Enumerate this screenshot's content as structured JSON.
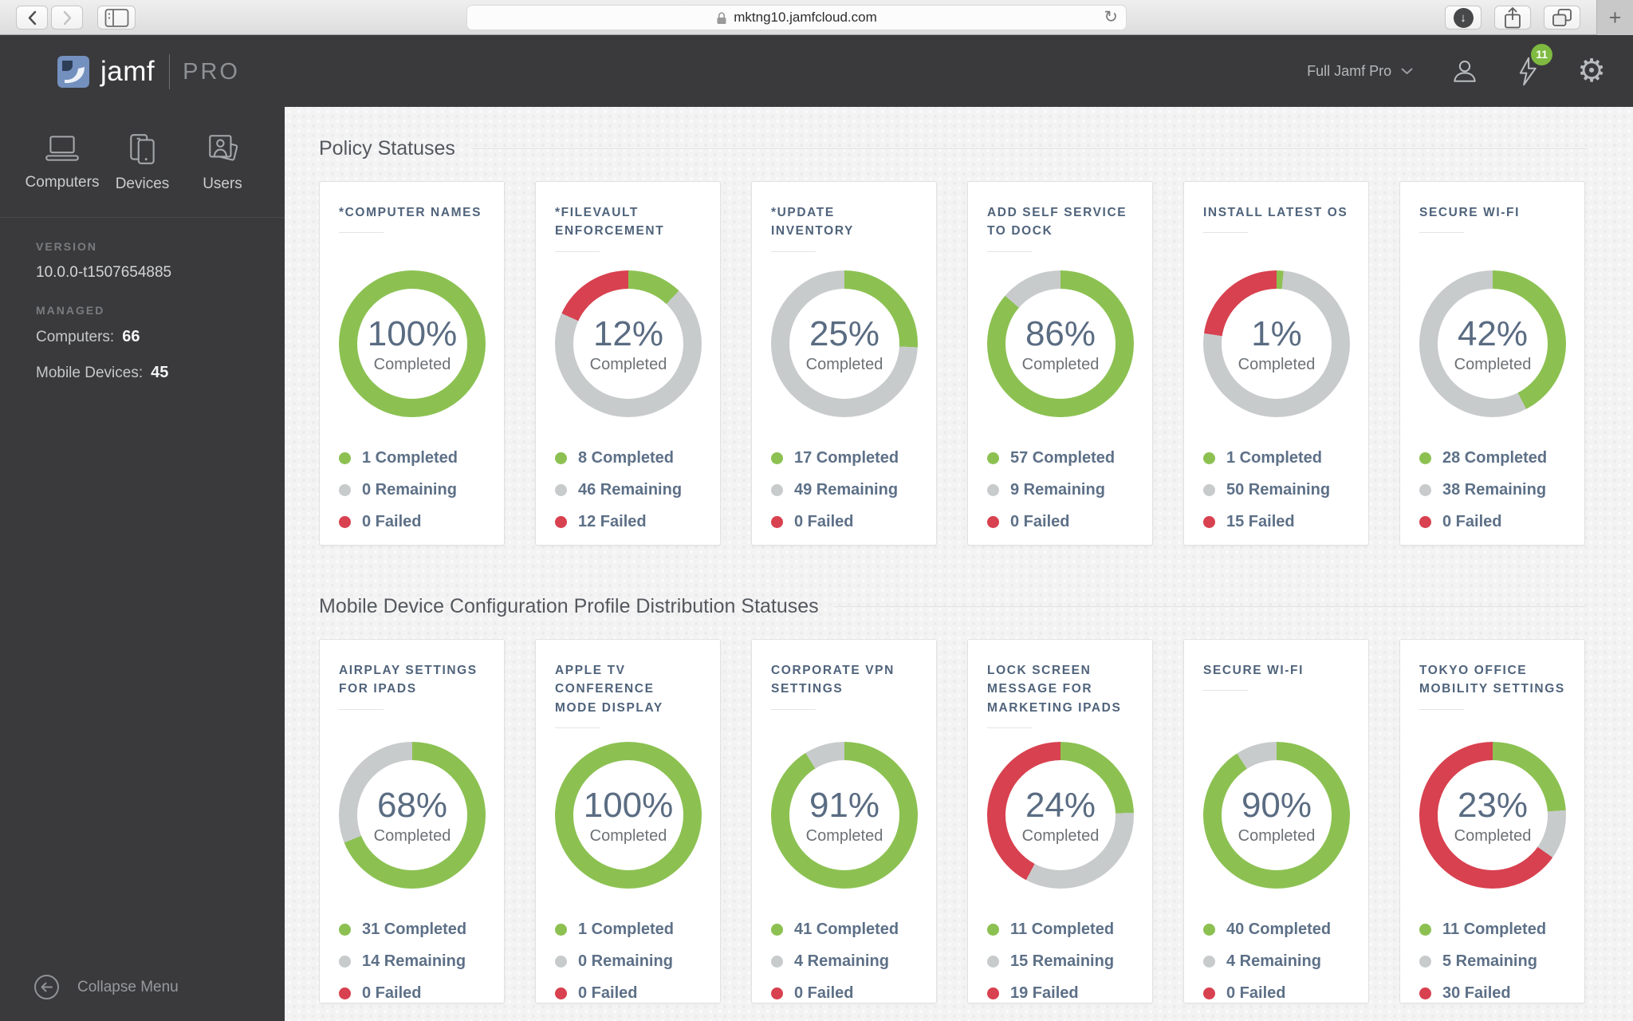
{
  "browser": {
    "url": "mktng10.jamfcloud.com",
    "new_tab_label": "+",
    "download_arrow": "↓",
    "reload_glyph": "↻"
  },
  "header": {
    "brand": "jamf",
    "brand_suffix": "PRO",
    "context_menu": "Full Jamf Pro",
    "notification_count": "11",
    "gear_glyph": "⚙"
  },
  "sidebar": {
    "nav": [
      {
        "label": "Computers"
      },
      {
        "label": "Devices"
      },
      {
        "label": "Users"
      }
    ],
    "version_label": "VERSION",
    "version": "10.0.0-t1507654885",
    "managed_label": "MANAGED",
    "managed": [
      {
        "label": "Computers:",
        "value": "66"
      },
      {
        "label": "Mobile Devices:",
        "value": "45"
      }
    ],
    "collapse_label": "Collapse Menu"
  },
  "card_labels": {
    "center_caption": "Completed",
    "completed": "Completed",
    "remaining": "Remaining",
    "failed": "Failed"
  },
  "colors": {
    "completed_green": "#8cc152",
    "remaining_gray": "#c8cbcc",
    "failed_red": "#d8414f",
    "badge_green": "#7fba41"
  },
  "sections": [
    {
      "title": "Policy Statuses",
      "cards": [
        {
          "title": "*COMPUTER NAMES",
          "percent": "100%",
          "completed": 1,
          "remaining": 0,
          "failed": 0
        },
        {
          "title": "*FILEVAULT ENFORCEMENT",
          "percent": "12%",
          "completed": 8,
          "remaining": 46,
          "failed": 12
        },
        {
          "title": "*UPDATE INVENTORY",
          "percent": "25%",
          "completed": 17,
          "remaining": 49,
          "failed": 0
        },
        {
          "title": "ADD SELF SERVICE TO DOCK",
          "percent": "86%",
          "completed": 57,
          "remaining": 9,
          "failed": 0
        },
        {
          "title": "INSTALL LATEST OS",
          "percent": "1%",
          "completed": 1,
          "remaining": 50,
          "failed": 15
        },
        {
          "title": "SECURE WI-FI",
          "percent": "42%",
          "completed": 28,
          "remaining": 38,
          "failed": 0
        }
      ]
    },
    {
      "title": "Mobile Device Configuration Profile Distribution Statuses",
      "cards": [
        {
          "title": "AIRPLAY SETTINGS FOR IPADS",
          "percent": "68%",
          "completed": 31,
          "remaining": 14,
          "failed": 0
        },
        {
          "title": "APPLE TV CONFERENCE MODE DISPLAY",
          "percent": "100%",
          "completed": 1,
          "remaining": 0,
          "failed": 0
        },
        {
          "title": "CORPORATE VPN SETTINGS",
          "percent": "91%",
          "completed": 41,
          "remaining": 4,
          "failed": 0
        },
        {
          "title": "LOCK SCREEN MESSAGE FOR MARKETING IPADS",
          "percent": "24%",
          "completed": 11,
          "remaining": 15,
          "failed": 19
        },
        {
          "title": "SECURE WI-FI",
          "percent": "90%",
          "completed": 40,
          "remaining": 4,
          "failed": 0
        },
        {
          "title": "TOKYO OFFICE MOBILITY SETTINGS",
          "percent": "23%",
          "completed": 11,
          "remaining": 5,
          "failed": 30
        }
      ]
    }
  ]
}
